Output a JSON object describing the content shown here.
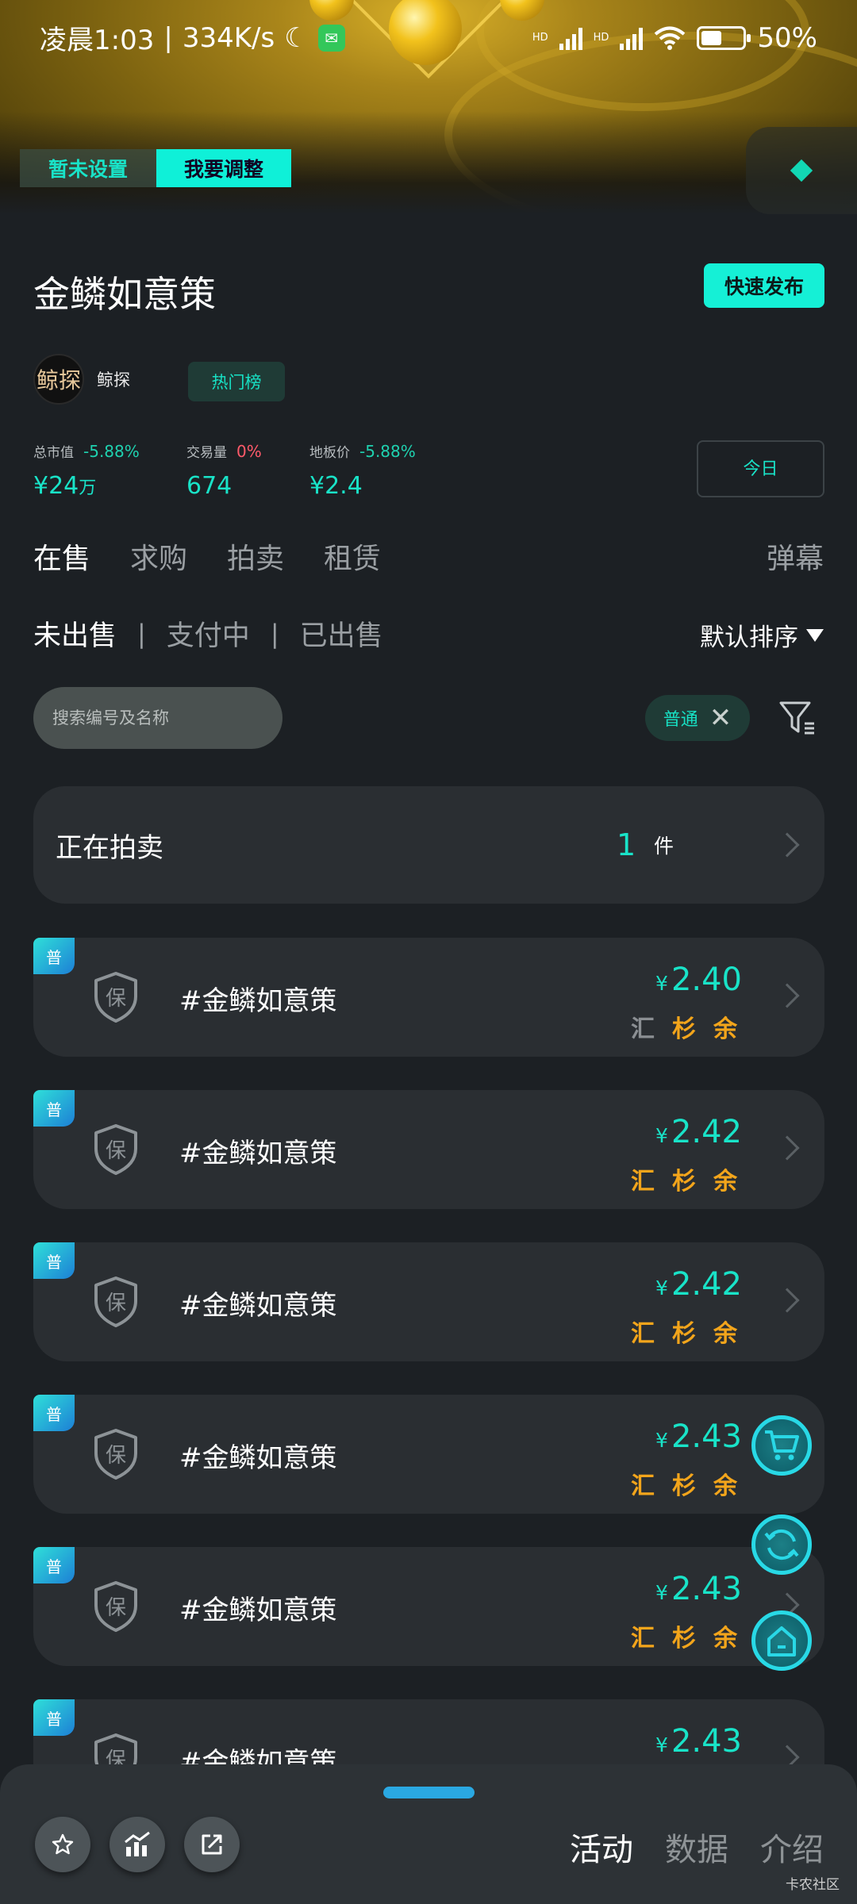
{
  "status_bar": {
    "time": "凌晨1:03",
    "speed": "334K/s",
    "hd1": "HD",
    "hd2": "HD",
    "battery": "50%",
    "battery_level": 0.5
  },
  "banner": {
    "toggle_off_label": "暂未设置",
    "toggle_on_label": "我要调整"
  },
  "header": {
    "title": "金鳞如意策",
    "publish_label": "快速发布",
    "brand_logo_text": "鲸探",
    "brand_name": "鲸探",
    "hot_label": "热门榜"
  },
  "stats": {
    "market_cap_label": "总市值",
    "market_cap_change": "-5.88%",
    "market_cap_currency": "¥",
    "market_cap_value": "24",
    "market_cap_unit": "万",
    "volume_label": "交易量",
    "volume_change": "0%",
    "volume_value": "674",
    "floor_label": "地板价",
    "floor_change": "-5.88%",
    "floor_value": "¥2.4",
    "period_label": "今日"
  },
  "main_tabs": [
    "在售",
    "求购",
    "拍卖",
    "租赁"
  ],
  "danmu_label": "弹幕",
  "sub_tabs": [
    "未出售",
    "支付中",
    "已出售"
  ],
  "sort_label": "默认排序",
  "search": {
    "placeholder": "搜索编号及名称"
  },
  "filter_chip": {
    "label": "普通"
  },
  "auction": {
    "label": "正在拍卖",
    "count": "1",
    "unit": "件"
  },
  "items": [
    {
      "tag": "普",
      "shield": "保",
      "name": "#金鳞如意策",
      "currency": "¥",
      "price": "2.40",
      "chars": [
        "汇",
        "杉",
        "余"
      ],
      "first_dim": true
    },
    {
      "tag": "普",
      "shield": "保",
      "name": "#金鳞如意策",
      "currency": "¥",
      "price": "2.42",
      "chars": [
        "汇",
        "杉",
        "余"
      ],
      "first_dim": false
    },
    {
      "tag": "普",
      "shield": "保",
      "name": "#金鳞如意策",
      "currency": "¥",
      "price": "2.42",
      "chars": [
        "汇",
        "杉",
        "余"
      ],
      "first_dim": false
    },
    {
      "tag": "普",
      "shield": "保",
      "name": "#金鳞如意策",
      "currency": "¥",
      "price": "2.43",
      "chars": [
        "汇",
        "杉",
        "余"
      ],
      "first_dim": false
    },
    {
      "tag": "普",
      "shield": "保",
      "name": "#金鳞如意策",
      "currency": "¥",
      "price": "2.43",
      "chars": [
        "汇",
        "杉",
        "余"
      ],
      "first_dim": false
    },
    {
      "tag": "普",
      "shield": "保",
      "name": "#金鳞如意策",
      "currency": "¥",
      "price": "2.43",
      "chars": [],
      "first_dim": false
    }
  ],
  "bottom_tabs": [
    "活动",
    "数据",
    "介绍"
  ],
  "watermark": "卡农社区",
  "colors": {
    "accent": "#19e3c8",
    "background": "#1c2024",
    "card": "#2a2e32",
    "gold": "#f3a51b",
    "negative_red": "#ff5a6a"
  },
  "icons": {
    "fab_1": "cart-icon",
    "fab_2": "refresh-icon",
    "fab_3": "home-icon",
    "bottom_1": "star-icon",
    "bottom_2": "chart-icon",
    "bottom_3": "share-icon"
  }
}
